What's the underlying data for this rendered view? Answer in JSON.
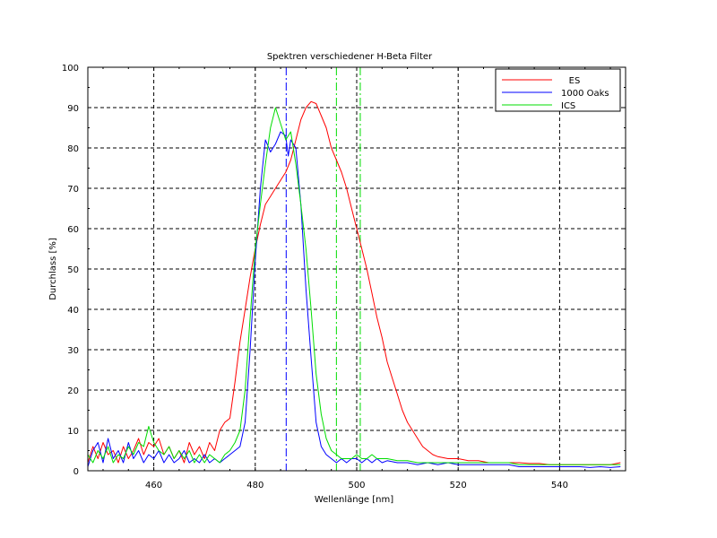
{
  "chart_data": {
    "type": "line",
    "title": "Spektren verschiedener H-Beta Filter",
    "xlabel": "Wellenlänge [nm]",
    "ylabel": "Durchlass [%]",
    "xlim": [
      447,
      553
    ],
    "ylim": [
      0,
      100
    ],
    "x_ticks": [
      460,
      480,
      500,
      520,
      540
    ],
    "y_ticks": [
      0,
      10,
      20,
      30,
      40,
      50,
      60,
      70,
      80,
      90,
      100
    ],
    "grid": true,
    "grid_style": "dashed",
    "legend_position": "top-right",
    "colors": {
      "ES": "#ff0000",
      "1000 Oaks": "#0000ff",
      "ICS": "#00dd00",
      "frame": "#000000"
    },
    "reference_lines": [
      {
        "x": 486.1,
        "color": "#0000ff",
        "style": "dash-dot"
      },
      {
        "x": 496.0,
        "color": "#00dd00",
        "style": "dash-dot"
      },
      {
        "x": 500.7,
        "color": "#00dd00",
        "style": "dash-dot"
      }
    ],
    "series": [
      {
        "name": "ES",
        "color": "#ff0000",
        "points": [
          [
            447,
            2
          ],
          [
            448,
            6
          ],
          [
            449,
            3
          ],
          [
            450,
            7
          ],
          [
            451,
            4
          ],
          [
            452,
            5
          ],
          [
            453,
            2
          ],
          [
            454,
            6
          ],
          [
            455,
            3
          ],
          [
            456,
            5
          ],
          [
            457,
            8
          ],
          [
            458,
            4
          ],
          [
            459,
            7
          ],
          [
            460,
            6
          ],
          [
            461,
            8
          ],
          [
            462,
            4
          ],
          [
            463,
            6
          ],
          [
            464,
            3
          ],
          [
            465,
            5
          ],
          [
            466,
            2
          ],
          [
            467,
            7
          ],
          [
            468,
            4
          ],
          [
            469,
            6
          ],
          [
            470,
            3
          ],
          [
            471,
            7
          ],
          [
            472,
            5
          ],
          [
            473,
            10
          ],
          [
            474,
            12
          ],
          [
            475,
            13
          ],
          [
            476,
            22
          ],
          [
            477,
            32
          ],
          [
            478,
            40
          ],
          [
            479,
            48
          ],
          [
            480,
            55
          ],
          [
            481,
            61
          ],
          [
            482,
            66
          ],
          [
            483,
            68
          ],
          [
            484,
            70
          ],
          [
            485,
            72
          ],
          [
            486,
            74
          ],
          [
            487,
            77
          ],
          [
            488,
            82
          ],
          [
            489,
            87
          ],
          [
            490,
            90
          ],
          [
            491,
            91.5
          ],
          [
            492,
            91
          ],
          [
            493,
            88
          ],
          [
            494,
            85
          ],
          [
            495,
            80
          ],
          [
            496,
            77
          ],
          [
            497,
            74
          ],
          [
            498,
            70
          ],
          [
            499,
            65
          ],
          [
            500,
            60
          ],
          [
            501,
            55
          ],
          [
            502,
            50
          ],
          [
            503,
            44
          ],
          [
            504,
            38
          ],
          [
            505,
            33
          ],
          [
            506,
            27
          ],
          [
            507,
            23
          ],
          [
            508,
            19
          ],
          [
            509,
            15
          ],
          [
            510,
            12
          ],
          [
            511,
            10
          ],
          [
            512,
            8
          ],
          [
            513,
            6
          ],
          [
            514,
            5
          ],
          [
            515,
            4
          ],
          [
            516,
            3.5
          ],
          [
            518,
            3
          ],
          [
            520,
            3
          ],
          [
            522,
            2.5
          ],
          [
            524,
            2.5
          ],
          [
            526,
            2
          ],
          [
            528,
            2
          ],
          [
            530,
            2
          ],
          [
            532,
            2
          ],
          [
            534,
            1.8
          ],
          [
            536,
            1.8
          ],
          [
            538,
            1.5
          ],
          [
            540,
            1.5
          ],
          [
            542,
            1.5
          ],
          [
            544,
            1.5
          ],
          [
            546,
            1.5
          ],
          [
            548,
            1.5
          ],
          [
            550,
            1.5
          ],
          [
            552,
            2
          ]
        ]
      },
      {
        "name": "1000 Oaks",
        "color": "#0000ff",
        "points": [
          [
            447,
            1
          ],
          [
            448,
            5
          ],
          [
            449,
            7
          ],
          [
            450,
            2
          ],
          [
            451,
            8
          ],
          [
            452,
            3
          ],
          [
            453,
            5
          ],
          [
            454,
            2
          ],
          [
            455,
            7
          ],
          [
            456,
            3
          ],
          [
            457,
            5
          ],
          [
            458,
            2
          ],
          [
            459,
            4
          ],
          [
            460,
            3
          ],
          [
            461,
            5
          ],
          [
            462,
            2
          ],
          [
            463,
            4
          ],
          [
            464,
            2
          ],
          [
            465,
            3
          ],
          [
            466,
            5
          ],
          [
            467,
            2
          ],
          [
            468,
            3
          ],
          [
            469,
            2
          ],
          [
            470,
            4
          ],
          [
            471,
            2
          ],
          [
            472,
            3
          ],
          [
            473,
            2
          ],
          [
            474,
            3
          ],
          [
            475,
            4
          ],
          [
            476,
            5
          ],
          [
            477,
            6
          ],
          [
            478,
            12
          ],
          [
            479,
            30
          ],
          [
            480,
            52
          ],
          [
            481,
            70
          ],
          [
            482,
            82
          ],
          [
            483,
            79
          ],
          [
            484,
            81
          ],
          [
            485,
            84
          ],
          [
            486,
            83
          ],
          [
            486.5,
            78
          ],
          [
            487,
            82
          ],
          [
            488,
            80
          ],
          [
            489,
            66
          ],
          [
            490,
            45
          ],
          [
            491,
            28
          ],
          [
            492,
            12
          ],
          [
            493,
            6
          ],
          [
            494,
            4
          ],
          [
            495,
            3
          ],
          [
            496,
            2
          ],
          [
            497,
            3
          ],
          [
            498,
            2
          ],
          [
            499,
            3
          ],
          [
            500,
            3
          ],
          [
            501,
            2
          ],
          [
            502,
            3
          ],
          [
            503,
            2
          ],
          [
            504,
            3
          ],
          [
            505,
            2
          ],
          [
            506,
            2.5
          ],
          [
            508,
            2
          ],
          [
            510,
            2
          ],
          [
            512,
            1.5
          ],
          [
            514,
            2
          ],
          [
            516,
            1.5
          ],
          [
            518,
            2
          ],
          [
            520,
            1.5
          ],
          [
            522,
            1.5
          ],
          [
            524,
            1.5
          ],
          [
            526,
            1.5
          ],
          [
            528,
            1.5
          ],
          [
            530,
            1.5
          ],
          [
            532,
            1
          ],
          [
            534,
            1
          ],
          [
            536,
            1
          ],
          [
            538,
            1
          ],
          [
            540,
            1
          ],
          [
            542,
            1
          ],
          [
            544,
            1
          ],
          [
            546,
            0.8
          ],
          [
            548,
            1
          ],
          [
            550,
            0.8
          ],
          [
            552,
            1
          ]
        ]
      },
      {
        "name": "ICS",
        "color": "#00dd00",
        "points": [
          [
            447,
            4
          ],
          [
            448,
            2
          ],
          [
            449,
            5
          ],
          [
            450,
            3
          ],
          [
            451,
            6
          ],
          [
            452,
            2
          ],
          [
            453,
            4
          ],
          [
            454,
            3
          ],
          [
            455,
            6
          ],
          [
            456,
            4
          ],
          [
            457,
            7
          ],
          [
            458,
            6
          ],
          [
            459,
            11
          ],
          [
            460,
            7
          ],
          [
            461,
            5
          ],
          [
            462,
            4
          ],
          [
            463,
            6
          ],
          [
            464,
            3
          ],
          [
            465,
            5
          ],
          [
            466,
            3
          ],
          [
            467,
            5
          ],
          [
            468,
            2
          ],
          [
            469,
            4
          ],
          [
            470,
            2
          ],
          [
            471,
            4
          ],
          [
            472,
            3
          ],
          [
            473,
            2
          ],
          [
            474,
            4
          ],
          [
            475,
            5
          ],
          [
            476,
            7
          ],
          [
            477,
            10
          ],
          [
            478,
            20
          ],
          [
            479,
            38
          ],
          [
            480,
            55
          ],
          [
            481,
            66
          ],
          [
            482,
            76
          ],
          [
            483,
            85
          ],
          [
            484,
            90
          ],
          [
            485,
            86
          ],
          [
            486,
            82
          ],
          [
            487,
            84
          ],
          [
            488,
            76
          ],
          [
            489,
            66
          ],
          [
            490,
            55
          ],
          [
            491,
            40
          ],
          [
            492,
            24
          ],
          [
            493,
            14
          ],
          [
            494,
            8
          ],
          [
            495,
            5
          ],
          [
            496,
            4
          ],
          [
            497,
            3
          ],
          [
            498,
            3
          ],
          [
            499,
            3
          ],
          [
            500,
            4
          ],
          [
            501,
            3
          ],
          [
            502,
            3
          ],
          [
            503,
            4
          ],
          [
            504,
            3
          ],
          [
            505,
            3
          ],
          [
            506,
            3
          ],
          [
            508,
            2.5
          ],
          [
            510,
            2.5
          ],
          [
            512,
            2
          ],
          [
            514,
            2
          ],
          [
            516,
            2
          ],
          [
            518,
            2
          ],
          [
            520,
            2
          ],
          [
            522,
            2
          ],
          [
            524,
            2
          ],
          [
            526,
            2
          ],
          [
            528,
            2
          ],
          [
            530,
            2
          ],
          [
            532,
            1.5
          ],
          [
            534,
            1.5
          ],
          [
            536,
            1.5
          ],
          [
            538,
            1.5
          ],
          [
            540,
            1.5
          ],
          [
            542,
            1.5
          ],
          [
            544,
            1.5
          ],
          [
            546,
            1.5
          ],
          [
            548,
            1.5
          ],
          [
            550,
            1.5
          ],
          [
            552,
            1.5
          ]
        ]
      }
    ]
  }
}
